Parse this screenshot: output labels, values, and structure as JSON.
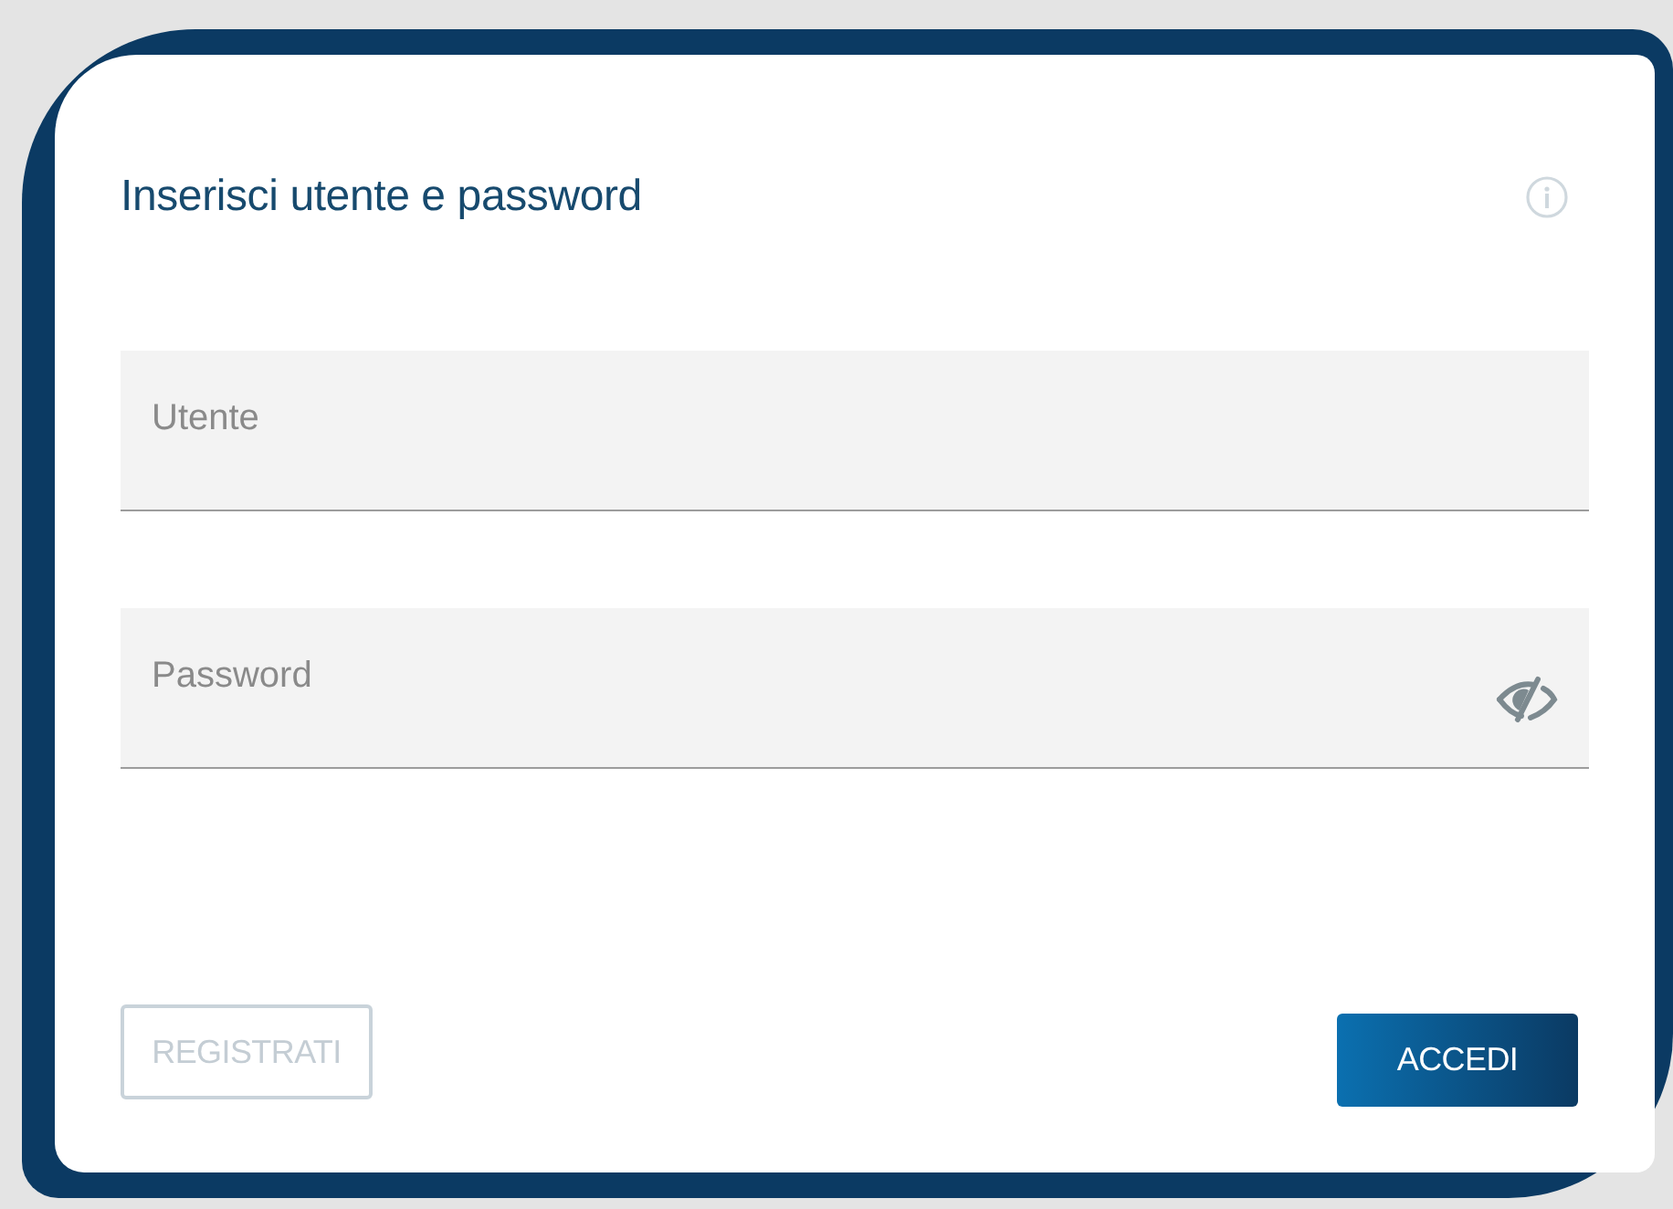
{
  "dialog": {
    "title": "Inserisci utente e password"
  },
  "fields": [
    {
      "kind": "text",
      "placeholder": "Utente"
    },
    {
      "kind": "password",
      "placeholder": "Password"
    }
  ],
  "buttons": [
    {
      "label": "REGISTRATI",
      "kind": "outline",
      "disabled": true
    },
    {
      "label": "ACCEDI",
      "kind": "primary",
      "disabled": false
    }
  ]
}
